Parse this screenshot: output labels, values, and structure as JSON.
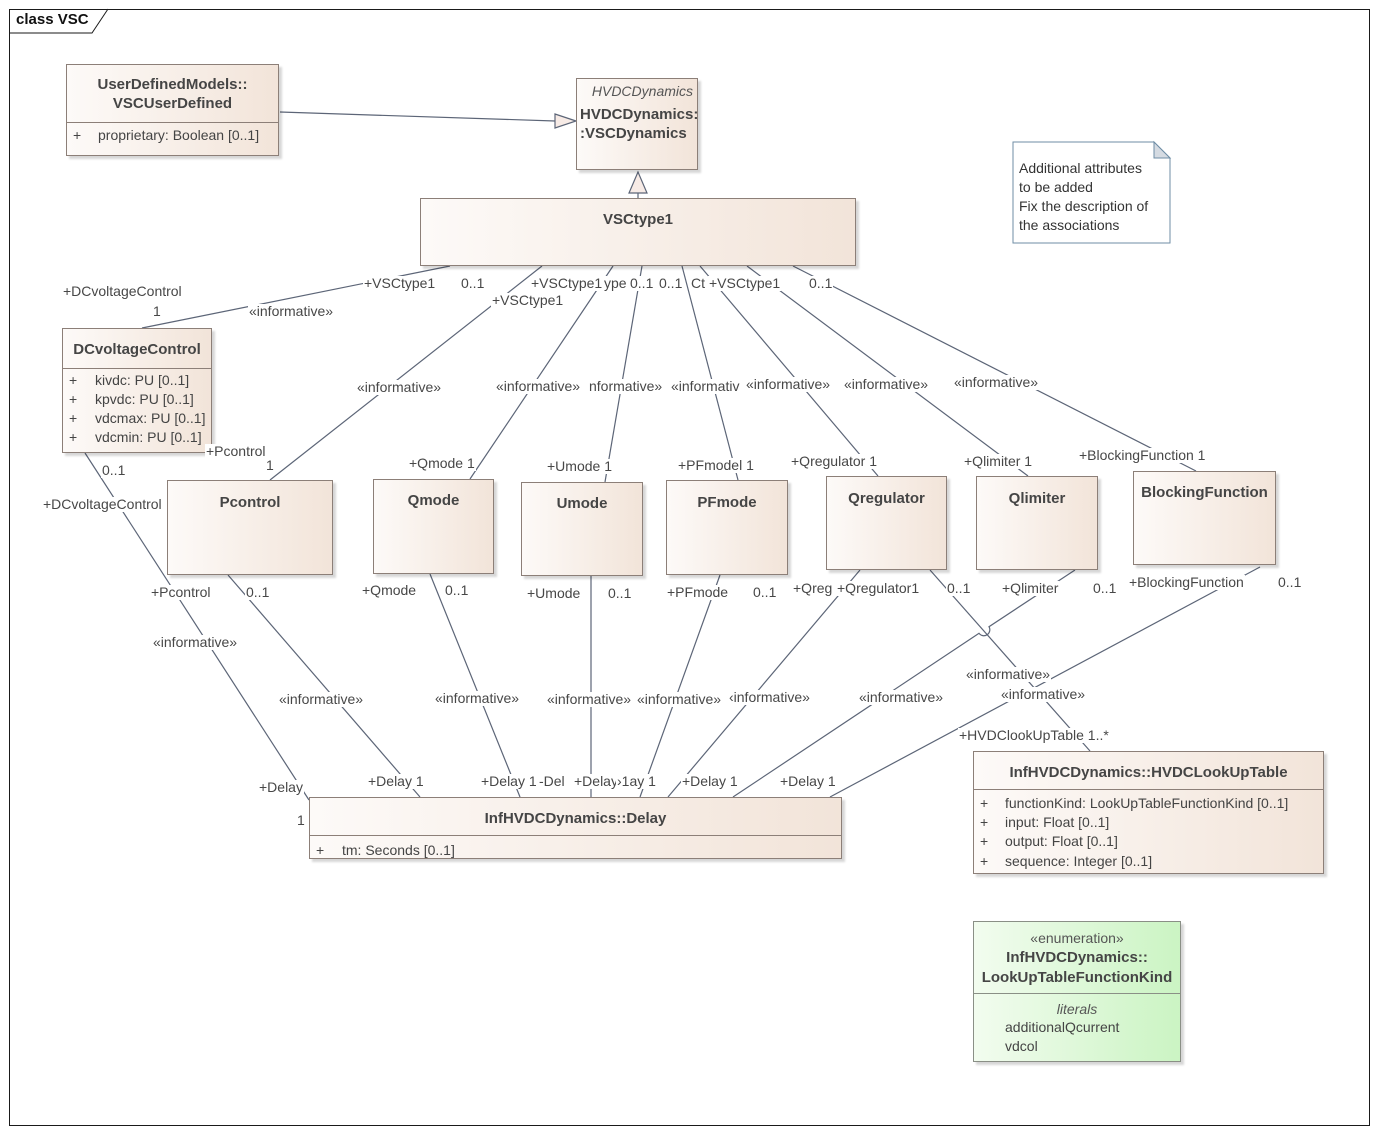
{
  "frame": {
    "label": "class VSC"
  },
  "classes": {
    "vsc_user_defined": {
      "title": [
        "UserDefinedModels::",
        "VSCUserDefined"
      ],
      "attributes": [
        {
          "visibility": "+",
          "text": "proprietary: Boolean [0..1]"
        }
      ]
    },
    "vsc_dynamics": {
      "package_label": "HVDCDynamics",
      "title": [
        "HVDCDynamics::",
        ":VSCDynamics"
      ]
    },
    "vsc_type1": {
      "title": "VSCtype1"
    },
    "dc_voltage_control": {
      "title": "DCvoltageControl",
      "attributes": [
        {
          "visibility": "+",
          "text": "kivdc: PU [0..1]"
        },
        {
          "visibility": "+",
          "text": "kpvdc: PU [0..1]"
        },
        {
          "visibility": "+",
          "text": "vdcmax: PU [0..1]"
        },
        {
          "visibility": "+",
          "text": "vdcmin: PU [0..1]"
        }
      ]
    },
    "pcontrol": {
      "title": "Pcontrol"
    },
    "qmode": {
      "title": "Qmode"
    },
    "umode": {
      "title": "Umode"
    },
    "pfmode": {
      "title": "PFmode"
    },
    "qregulator": {
      "title": "Qregulator"
    },
    "qlimiter": {
      "title": "Qlimiter"
    },
    "blocking_function": {
      "title": "BlockingFunction"
    },
    "delay": {
      "title": "InfHVDCDynamics::Delay",
      "attributes": [
        {
          "visibility": "+",
          "text": "tm: Seconds [0..1]"
        }
      ]
    },
    "hvdc_lookup_table": {
      "title": "InfHVDCDynamics::HVDCLookUpTable",
      "attributes": [
        {
          "visibility": "+",
          "text": "functionKind: LookUpTableFunctionKind [0..1]"
        },
        {
          "visibility": "+",
          "text": "input: Float [0..1]"
        },
        {
          "visibility": "+",
          "text": "output: Float [0..1]"
        },
        {
          "visibility": "+",
          "text": "sequence: Integer [0..1]"
        }
      ]
    },
    "lookup_table_function_kind": {
      "stereotype": "«enumeration»",
      "title": [
        "InfHVDCDynamics::",
        "LookUpTableFunctionKind"
      ],
      "section_label": "literals",
      "literals": [
        "additionalQcurrent",
        "vdcol"
      ]
    }
  },
  "note": {
    "lines": [
      "Additional attributes",
      "to be added",
      "Fix the description of",
      "the associations"
    ]
  },
  "associations": {
    "top": [
      {
        "target": "DCvoltageControl",
        "source_role": "+VSCtype1",
        "source_mult": "0..1",
        "target_role": "+DCvoltageControl",
        "target_mult": "1",
        "stereotype": "«informative»"
      },
      {
        "target": "Pcontrol",
        "source_role": "+VSCtype1",
        "target_role": "+Pcontrol",
        "target_mult": "1",
        "stereotype": "«informative»"
      },
      {
        "target": "Qmode",
        "source_role": "+VSCtype1",
        "target_end": "+Qmode 1",
        "stereotype": "«informative»"
      },
      {
        "target": "Umode",
        "source_role_fragment": "ype",
        "source_mult": "0..1",
        "target_end": "+Umode 1",
        "stereotype": "nformative»"
      },
      {
        "target": "PFmode",
        "source_mult": "0..1",
        "source_role_fragment": "Ct",
        "target_end": "+PFmodel 1",
        "stereotype": "«informativ"
      },
      {
        "target": "Qregulator",
        "source_role": "+VSCtype1",
        "target_end": "+Qregulator  1",
        "stereotype": "«informative»"
      },
      {
        "target": "Qlimiter",
        "target_end": "+Qlimiter  1",
        "stereotype": "«informative»"
      },
      {
        "target": "BlockingFunction",
        "source_mult": "0..1",
        "target_end": "+BlockingFunction 1",
        "stereotype": "«informative»"
      }
    ],
    "lower": [
      {
        "source": "DCvoltageControl",
        "target": "Delay",
        "source_mult": "0..1",
        "source_role": "+DCvoltageControl",
        "stereotype": "«informative»",
        "target_role": "+Delay",
        "target_mult": "1"
      },
      {
        "source": "Pcontrol",
        "target": "Delay",
        "source_role": "+Pcontrol",
        "source_mult": "0..1",
        "stereotype": "«informative»",
        "target_end": "+Delay  1"
      },
      {
        "source": "Qmode",
        "target": "Delay",
        "source_role": "+Qmode",
        "source_mult": "0..1",
        "stereotype": "«informative»",
        "target_end": "+Delay  1"
      },
      {
        "source": "Umode",
        "target": "Delay",
        "source_role": "+Umode",
        "source_mult": "0..1",
        "stereotype": "«informative»",
        "target_fragment": "-Del",
        "target_role": "+Delay"
      },
      {
        "source": "PFmode",
        "target": "Delay",
        "source_role": "+PFmode",
        "source_mult": "0..1",
        "stereotype": "«informative»",
        "target_fragment": "›1ay  1"
      },
      {
        "source": "Qregulator",
        "target": "Delay",
        "source_role_fragment": "+Qreg",
        "stereotype": "‹informative»",
        "target_end": "+Delay  1"
      },
      {
        "source": "Qlimiter",
        "target": "Delay",
        "source_role": "+Qlimiter",
        "source_mult": "0..1",
        "stereotype": "«informative»",
        "target_end": "+Delay  1"
      },
      {
        "source": "BlockingFunction",
        "target": "Delay",
        "source_role": "+BlockingFunction",
        "source_mult": "0..1",
        "stereotype": "«informative»"
      },
      {
        "source": "Qregulator",
        "target": "HVDCLookUpTable",
        "source_role": "+Qregulator1",
        "source_mult": "0..1",
        "stereotype": "«informative»",
        "target_end": "+HVDClookUpTable 1..*"
      }
    ]
  },
  "colors": {
    "class_fill_light": "#fdfaf8",
    "class_fill_dark": "#f2e4d9",
    "class_border": "#8c7f78",
    "enum_fill_light": "#f2fcef",
    "enum_fill_dark": "#cbf4c3",
    "connector": "#5c6577",
    "note_border": "#6f8ea6",
    "text": "#444444"
  }
}
